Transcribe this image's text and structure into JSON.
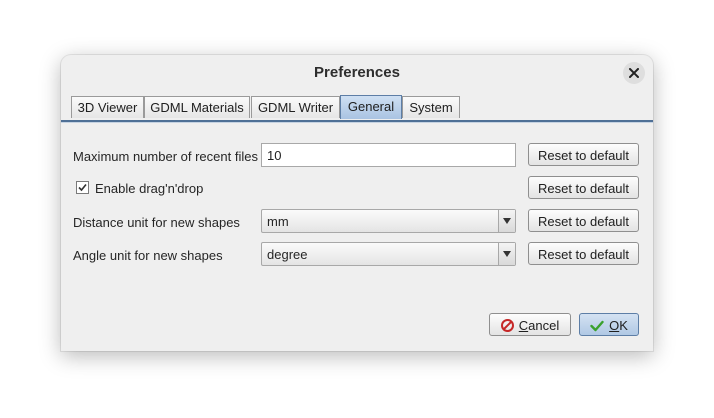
{
  "dialog": {
    "title": "Preferences",
    "close_icon": "close-icon"
  },
  "tabs": [
    {
      "label": "3D Viewer",
      "active": false
    },
    {
      "label": "GDML Materials",
      "active": false
    },
    {
      "label": "GDML Writer",
      "active": false
    },
    {
      "label": "General",
      "active": true
    },
    {
      "label": "System",
      "active": false
    }
  ],
  "general": {
    "recent_files": {
      "label": "Maximum number of recent files",
      "value": "10",
      "reset_label": "Reset to default"
    },
    "drag_drop": {
      "label": "Enable drag'n'drop",
      "checked": true,
      "reset_label": "Reset to default"
    },
    "distance_unit": {
      "label": "Distance unit for new shapes",
      "value": "mm",
      "reset_label": "Reset to default"
    },
    "angle_unit": {
      "label": "Angle unit for new shapes",
      "value": "degree",
      "reset_label": "Reset to default"
    }
  },
  "footer": {
    "cancel": {
      "mnemonic": "C",
      "rest": "ancel",
      "icon": "cancel-icon"
    },
    "ok": {
      "mnemonic": "O",
      "rest": "K",
      "icon": "checkmark-icon"
    }
  },
  "colors": {
    "accent": "#5d7ea6",
    "tab_line": "#4f7096",
    "cancel_icon": "#c62828",
    "ok_icon": "#3aa12e"
  }
}
